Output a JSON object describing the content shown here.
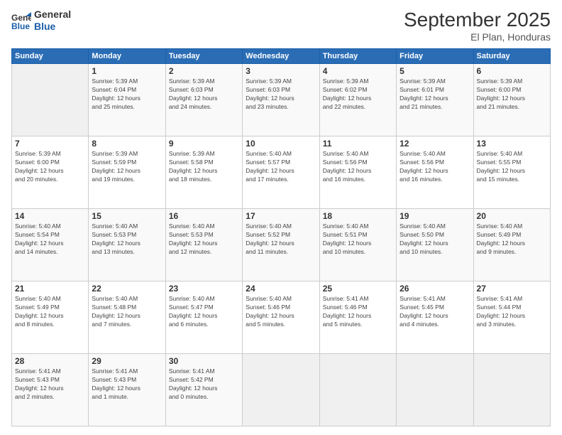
{
  "header": {
    "logo_line1": "General",
    "logo_line2": "Blue",
    "title": "September 2025",
    "subtitle": "El Plan, Honduras"
  },
  "days_of_week": [
    "Sunday",
    "Monday",
    "Tuesday",
    "Wednesday",
    "Thursday",
    "Friday",
    "Saturday"
  ],
  "weeks": [
    [
      {
        "day": "",
        "info": ""
      },
      {
        "day": "1",
        "info": "Sunrise: 5:39 AM\nSunset: 6:04 PM\nDaylight: 12 hours\nand 25 minutes."
      },
      {
        "day": "2",
        "info": "Sunrise: 5:39 AM\nSunset: 6:03 PM\nDaylight: 12 hours\nand 24 minutes."
      },
      {
        "day": "3",
        "info": "Sunrise: 5:39 AM\nSunset: 6:03 PM\nDaylight: 12 hours\nand 23 minutes."
      },
      {
        "day": "4",
        "info": "Sunrise: 5:39 AM\nSunset: 6:02 PM\nDaylight: 12 hours\nand 22 minutes."
      },
      {
        "day": "5",
        "info": "Sunrise: 5:39 AM\nSunset: 6:01 PM\nDaylight: 12 hours\nand 21 minutes."
      },
      {
        "day": "6",
        "info": "Sunrise: 5:39 AM\nSunset: 6:00 PM\nDaylight: 12 hours\nand 21 minutes."
      }
    ],
    [
      {
        "day": "7",
        "info": "Sunrise: 5:39 AM\nSunset: 6:00 PM\nDaylight: 12 hours\nand 20 minutes."
      },
      {
        "day": "8",
        "info": "Sunrise: 5:39 AM\nSunset: 5:59 PM\nDaylight: 12 hours\nand 19 minutes."
      },
      {
        "day": "9",
        "info": "Sunrise: 5:39 AM\nSunset: 5:58 PM\nDaylight: 12 hours\nand 18 minutes."
      },
      {
        "day": "10",
        "info": "Sunrise: 5:40 AM\nSunset: 5:57 PM\nDaylight: 12 hours\nand 17 minutes."
      },
      {
        "day": "11",
        "info": "Sunrise: 5:40 AM\nSunset: 5:56 PM\nDaylight: 12 hours\nand 16 minutes."
      },
      {
        "day": "12",
        "info": "Sunrise: 5:40 AM\nSunset: 5:56 PM\nDaylight: 12 hours\nand 16 minutes."
      },
      {
        "day": "13",
        "info": "Sunrise: 5:40 AM\nSunset: 5:55 PM\nDaylight: 12 hours\nand 15 minutes."
      }
    ],
    [
      {
        "day": "14",
        "info": "Sunrise: 5:40 AM\nSunset: 5:54 PM\nDaylight: 12 hours\nand 14 minutes."
      },
      {
        "day": "15",
        "info": "Sunrise: 5:40 AM\nSunset: 5:53 PM\nDaylight: 12 hours\nand 13 minutes."
      },
      {
        "day": "16",
        "info": "Sunrise: 5:40 AM\nSunset: 5:53 PM\nDaylight: 12 hours\nand 12 minutes."
      },
      {
        "day": "17",
        "info": "Sunrise: 5:40 AM\nSunset: 5:52 PM\nDaylight: 12 hours\nand 11 minutes."
      },
      {
        "day": "18",
        "info": "Sunrise: 5:40 AM\nSunset: 5:51 PM\nDaylight: 12 hours\nand 10 minutes."
      },
      {
        "day": "19",
        "info": "Sunrise: 5:40 AM\nSunset: 5:50 PM\nDaylight: 12 hours\nand 10 minutes."
      },
      {
        "day": "20",
        "info": "Sunrise: 5:40 AM\nSunset: 5:49 PM\nDaylight: 12 hours\nand 9 minutes."
      }
    ],
    [
      {
        "day": "21",
        "info": "Sunrise: 5:40 AM\nSunset: 5:49 PM\nDaylight: 12 hours\nand 8 minutes."
      },
      {
        "day": "22",
        "info": "Sunrise: 5:40 AM\nSunset: 5:48 PM\nDaylight: 12 hours\nand 7 minutes."
      },
      {
        "day": "23",
        "info": "Sunrise: 5:40 AM\nSunset: 5:47 PM\nDaylight: 12 hours\nand 6 minutes."
      },
      {
        "day": "24",
        "info": "Sunrise: 5:40 AM\nSunset: 5:46 PM\nDaylight: 12 hours\nand 5 minutes."
      },
      {
        "day": "25",
        "info": "Sunrise: 5:41 AM\nSunset: 5:46 PM\nDaylight: 12 hours\nand 5 minutes."
      },
      {
        "day": "26",
        "info": "Sunrise: 5:41 AM\nSunset: 5:45 PM\nDaylight: 12 hours\nand 4 minutes."
      },
      {
        "day": "27",
        "info": "Sunrise: 5:41 AM\nSunset: 5:44 PM\nDaylight: 12 hours\nand 3 minutes."
      }
    ],
    [
      {
        "day": "28",
        "info": "Sunrise: 5:41 AM\nSunset: 5:43 PM\nDaylight: 12 hours\nand 2 minutes."
      },
      {
        "day": "29",
        "info": "Sunrise: 5:41 AM\nSunset: 5:43 PM\nDaylight: 12 hours\nand 1 minute."
      },
      {
        "day": "30",
        "info": "Sunrise: 5:41 AM\nSunset: 5:42 PM\nDaylight: 12 hours\nand 0 minutes."
      },
      {
        "day": "",
        "info": ""
      },
      {
        "day": "",
        "info": ""
      },
      {
        "day": "",
        "info": ""
      },
      {
        "day": "",
        "info": ""
      }
    ]
  ]
}
